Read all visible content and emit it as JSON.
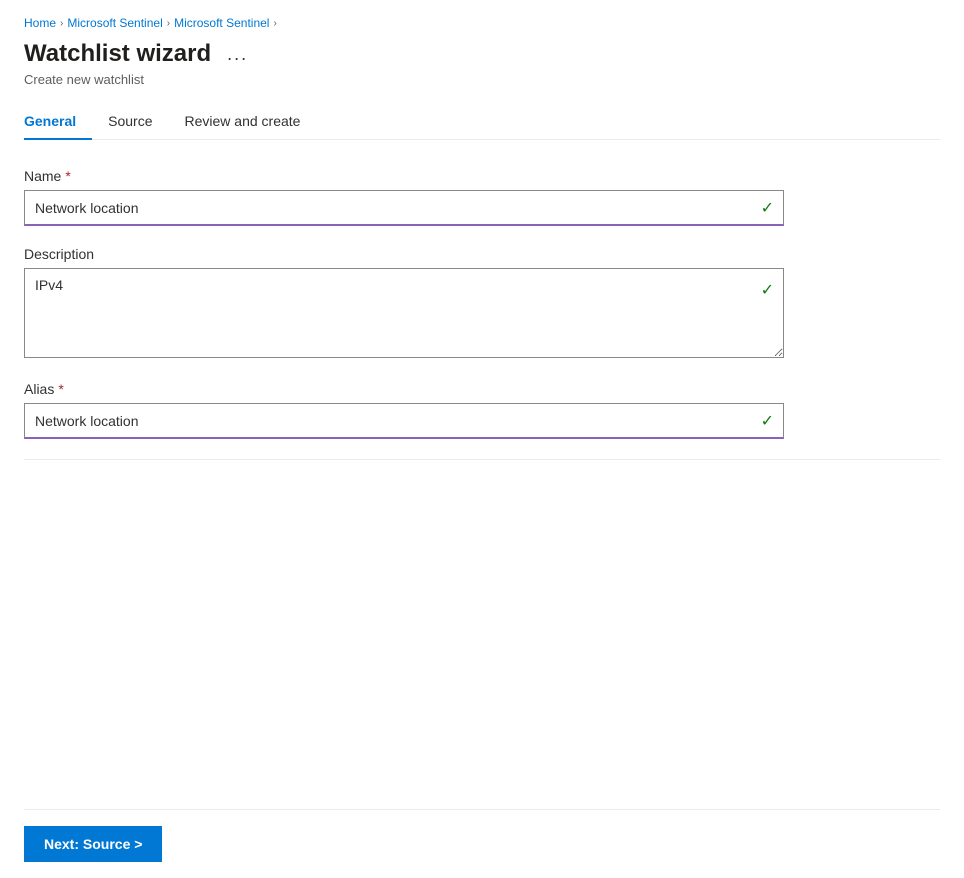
{
  "breadcrumb": {
    "items": [
      {
        "label": "Home",
        "href": "#"
      },
      {
        "label": "Microsoft Sentinel",
        "href": "#"
      },
      {
        "label": "Microsoft Sentinel",
        "href": "#"
      }
    ]
  },
  "header": {
    "title": "Watchlist wizard",
    "subtitle": "Create new watchlist",
    "more_options_label": "..."
  },
  "tabs": [
    {
      "id": "general",
      "label": "General",
      "active": true
    },
    {
      "id": "source",
      "label": "Source",
      "active": false
    },
    {
      "id": "review",
      "label": "Review and create",
      "active": false
    }
  ],
  "form": {
    "name_label": "Name",
    "name_required": "*",
    "name_value": "Network location",
    "description_label": "Description",
    "description_value": "IPv4",
    "alias_label": "Alias",
    "alias_required": "*",
    "alias_value": "Network location"
  },
  "footer": {
    "next_button_label": "Next: Source >"
  },
  "icons": {
    "checkmark": "✓",
    "chevron_right": "›"
  }
}
